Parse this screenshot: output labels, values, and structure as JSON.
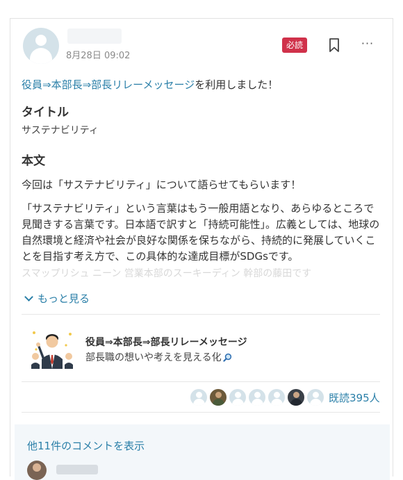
{
  "post": {
    "timestamp": "8月28日 09:02",
    "badge": "必読",
    "used_link": "役員⇒本部長⇒部長リレーメッセージ",
    "used_suffix": "を利用しました！",
    "title_heading": "タイトル",
    "title_value": "サステナビリティ",
    "body_heading": "本文",
    "body_p1": "今回は「サステナビリティ」について語らせてもらいます！",
    "body_p2": "「サステナビリティ」という言葉はもう一般用語となり、あらゆるところで見聞きする言葉です。日本語で訳すと「持続可能性」。広義としては、地球の自然環境と経済や社会が良好な関係を保ちながら、持続的に発展していくことを目指す考え方で、この具体的な達成目標がSDGsです。",
    "body_faded": "スマップリシュ ニーン 営業本部のスーキーディン 幹部の藤田です",
    "more_label": "もっと見る"
  },
  "channel": {
    "title": "役員⇒本部長⇒部長リレーメッセージ",
    "description": "部長職の想いや考えを見える化"
  },
  "readers": {
    "count_label": "既読395人"
  },
  "comments": {
    "show_label": "他11件のコメントを表示"
  },
  "colors": {
    "accent": "#2a7fa8",
    "badge": "#d0314a",
    "panel": "#f3f7fa"
  }
}
